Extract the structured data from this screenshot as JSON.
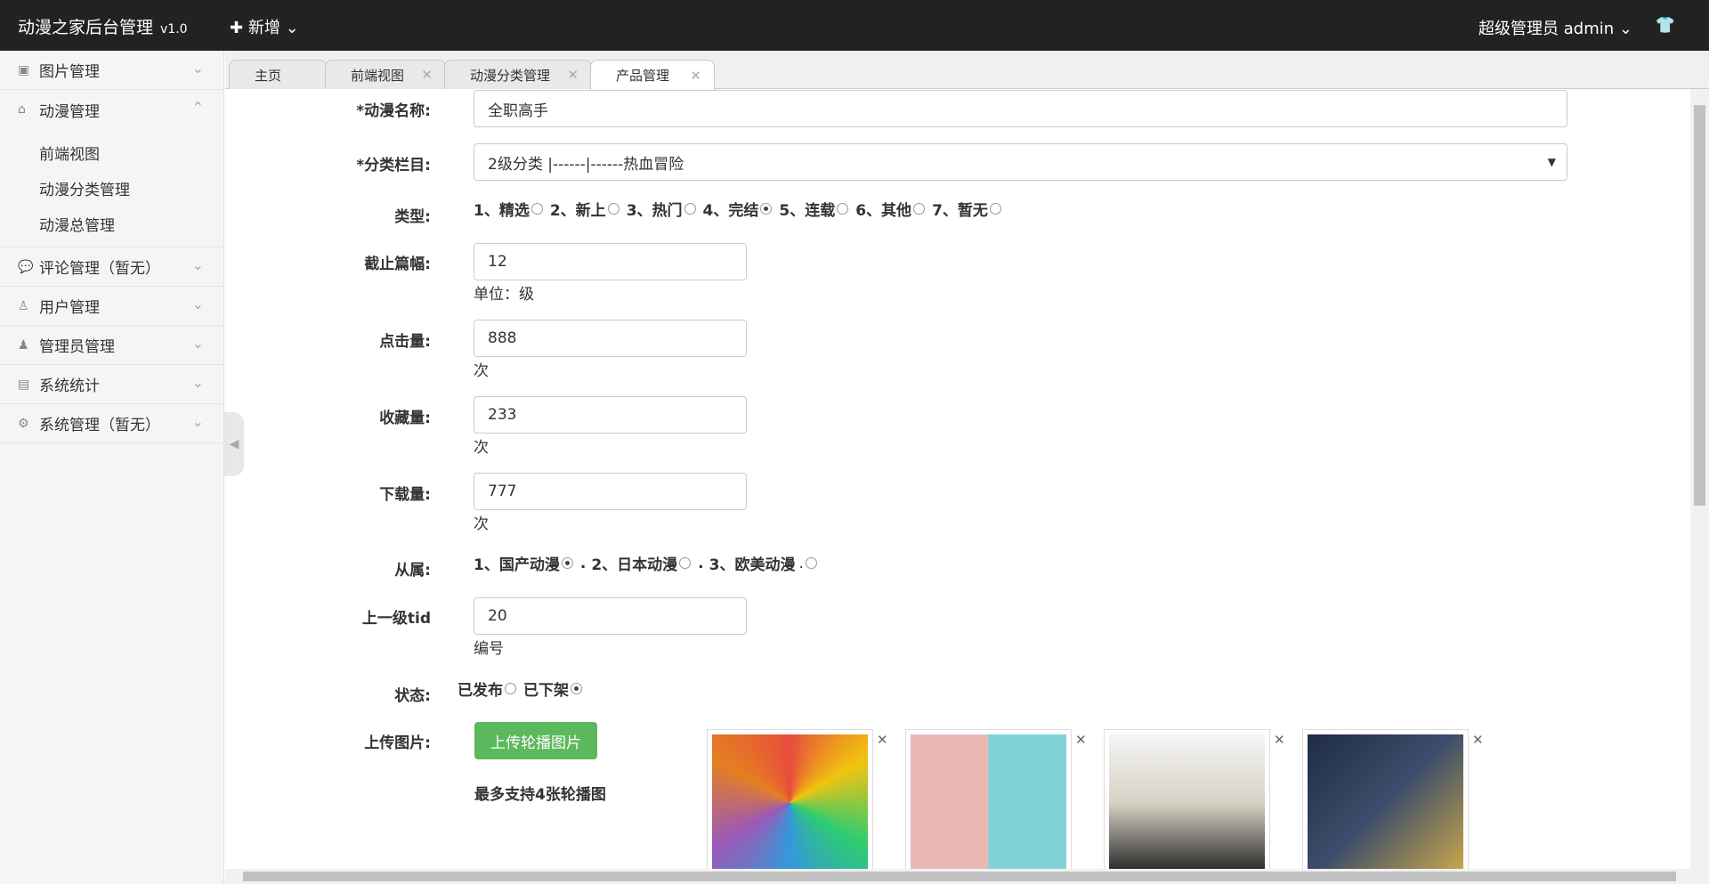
{
  "header": {
    "title": "动漫之家后台管理",
    "version": "v1.0",
    "new_button": "新增",
    "admin_role": "超级管理员",
    "admin_name": "admin"
  },
  "sidebar": {
    "items": [
      {
        "label": "图片管理",
        "icon": "image-icon"
      },
      {
        "label": "动漫管理",
        "icon": "bag-icon",
        "expanded": true
      },
      {
        "label": "评论管理（暂无）",
        "icon": "comment-icon"
      },
      {
        "label": "用户管理",
        "icon": "user-icon"
      },
      {
        "label": "管理员管理",
        "icon": "admin-icon"
      },
      {
        "label": "系统统计",
        "icon": "stats-icon"
      },
      {
        "label": "系统管理（暂无）",
        "icon": "gear-icon"
      }
    ],
    "subitems": [
      "前端视图",
      "动漫分类管理",
      "动漫总管理"
    ]
  },
  "tabs": [
    {
      "label": "主页",
      "closable": false
    },
    {
      "label": "前端视图",
      "closable": true
    },
    {
      "label": "动漫分类管理",
      "closable": true
    },
    {
      "label": "产品管理",
      "closable": true,
      "active": true
    }
  ],
  "form": {
    "name_label": "*动漫名称:",
    "name_value": "全职高手",
    "category_label": "*分类栏目:",
    "category_value": "2级分类 |------|------热血冒险",
    "type_label": "类型:",
    "type_options": [
      "1、精选",
      "2、新上",
      "3、热门",
      "4、完结",
      "5、连载",
      "6、其他",
      "7、暂无"
    ],
    "type_selected": 3,
    "chapters_label": "截止篇幅:",
    "chapters_value": "12",
    "chapters_unit": "单位：级",
    "clicks_label": "点击量:",
    "clicks_value": "888",
    "clicks_unit": "次",
    "favs_label": "收藏量:",
    "favs_value": "233",
    "favs_unit": "次",
    "downloads_label": "下载量:",
    "downloads_value": "777",
    "downloads_unit": "次",
    "belong_label": "从属:",
    "belong_options": [
      "1、国产动漫",
      "2、日本动漫",
      "3、欧美动漫"
    ],
    "belong_selected": 0,
    "parent_label": "上一级tid",
    "parent_value": "20",
    "parent_unit": "编号",
    "status_label": "状态:",
    "status_options": [
      "已发布",
      "已下架"
    ],
    "status_selected": 1,
    "upload_label": "上传图片:",
    "upload_button": "上传轮播图片",
    "upload_tip": "最多支持4张轮播图"
  },
  "colors": {
    "topbar": "#222222",
    "upload_button": "#5cb85c"
  }
}
